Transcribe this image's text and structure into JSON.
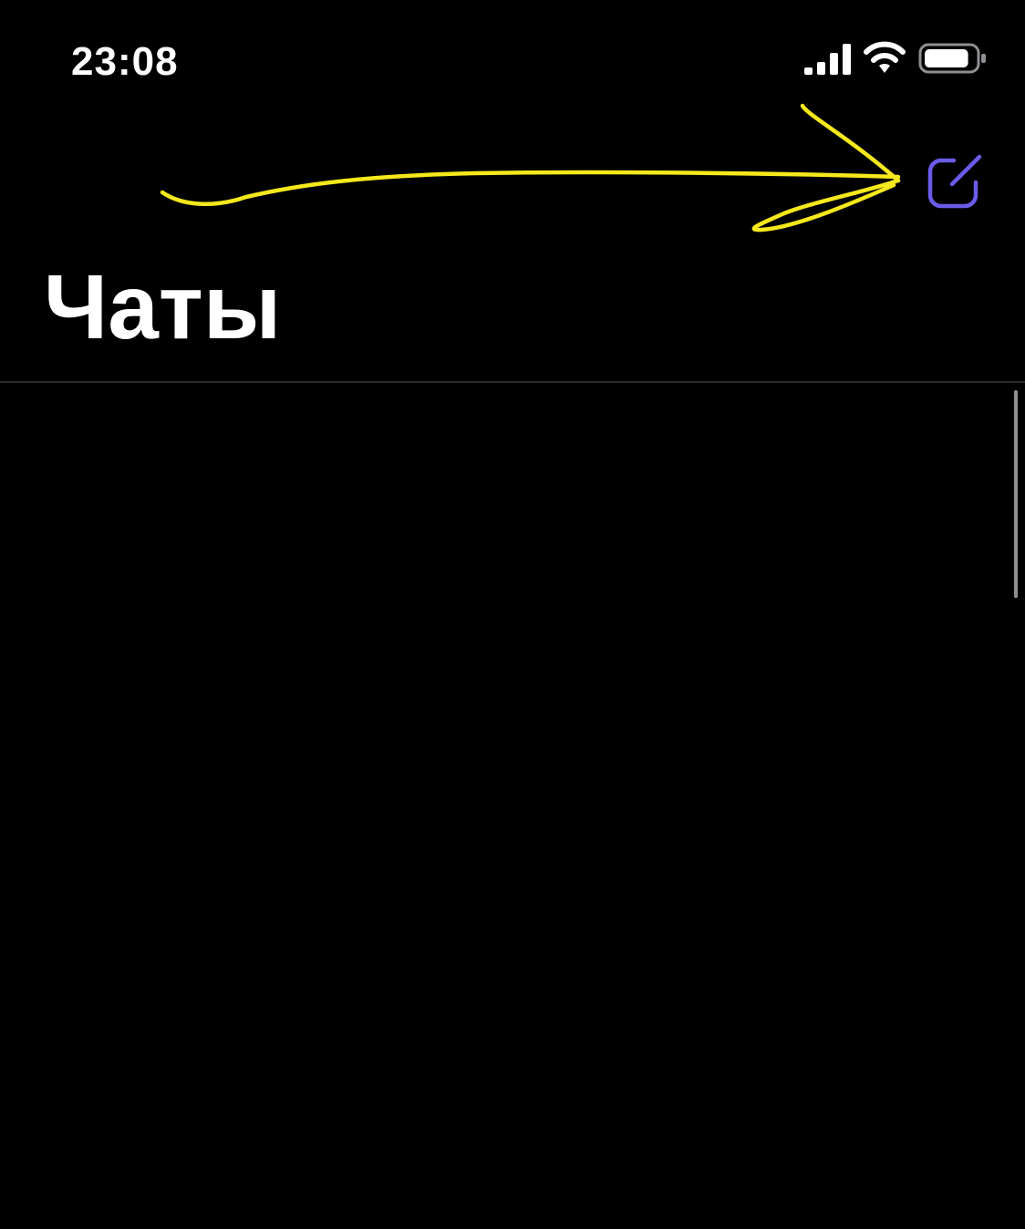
{
  "status_bar": {
    "time": "23:08",
    "signal_icon": "cellular-signal-icon",
    "wifi_icon": "wifi-icon",
    "battery_icon": "battery-icon",
    "battery_level": 0.85
  },
  "nav_bar": {
    "compose_icon": "compose-icon",
    "accent_color": "#6a5ce8"
  },
  "annotation": {
    "arrow_color": "#f5e81c"
  },
  "header": {
    "title": "Чаты"
  },
  "chat_list": {
    "items": []
  }
}
